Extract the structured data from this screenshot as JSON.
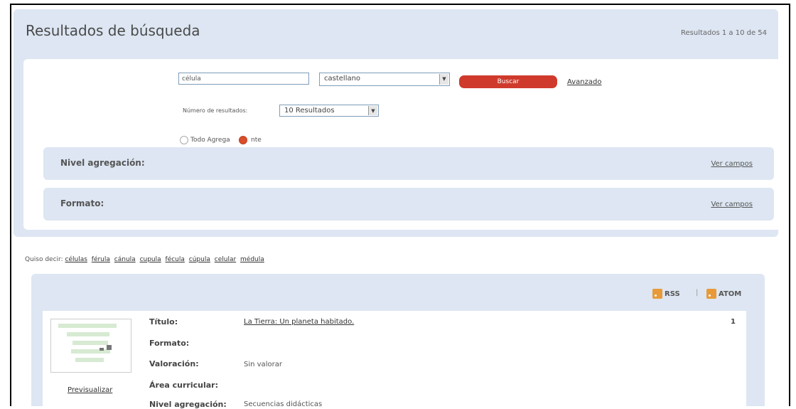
{
  "header": {
    "title": "Resultados de búsqueda",
    "results_count": "Resultados 1 a 10 de 54"
  },
  "search": {
    "query_value": "célula",
    "language_value": "castellano",
    "search_button": "Buscar",
    "advanced_link": "Avanzado",
    "num_results_label": "Número de resultados:",
    "num_results_value": "10 Resultados",
    "scope_options": [
      {
        "label": "Todo Agrega",
        "selected": false
      },
      {
        "label": "nte",
        "selected": true
      }
    ]
  },
  "facets": [
    {
      "title": "Nivel agregación:",
      "link": "Ver campos"
    },
    {
      "title": "Formato:",
      "link": "Ver campos"
    }
  ],
  "did_you_mean": {
    "label": "Quiso decir:",
    "words": [
      "células",
      "férula",
      "cánula",
      "cupula",
      "fécula",
      "cúpula",
      "celular",
      "médula"
    ]
  },
  "feeds": {
    "rss": "RSS",
    "atom": "ATOM",
    "separator": "|"
  },
  "result": {
    "index": "1",
    "preview_link": "Previsualizar",
    "fields": [
      {
        "label": "Título:",
        "value": "La Tierra: Un planeta habitado."
      },
      {
        "label": "Formato:",
        "value": ""
      },
      {
        "label": "Valoración:",
        "value": "Sin valorar"
      },
      {
        "label": "Área curricular:",
        "value": ""
      },
      {
        "label": "Nivel agregación:",
        "value": "Secuencias didácticas"
      }
    ]
  },
  "colors": {
    "panel_bg": "#dde6f2",
    "search_button": "#cf3a2c",
    "radio_selected": "#d94e2a",
    "feed_icon": "#e89a38"
  }
}
